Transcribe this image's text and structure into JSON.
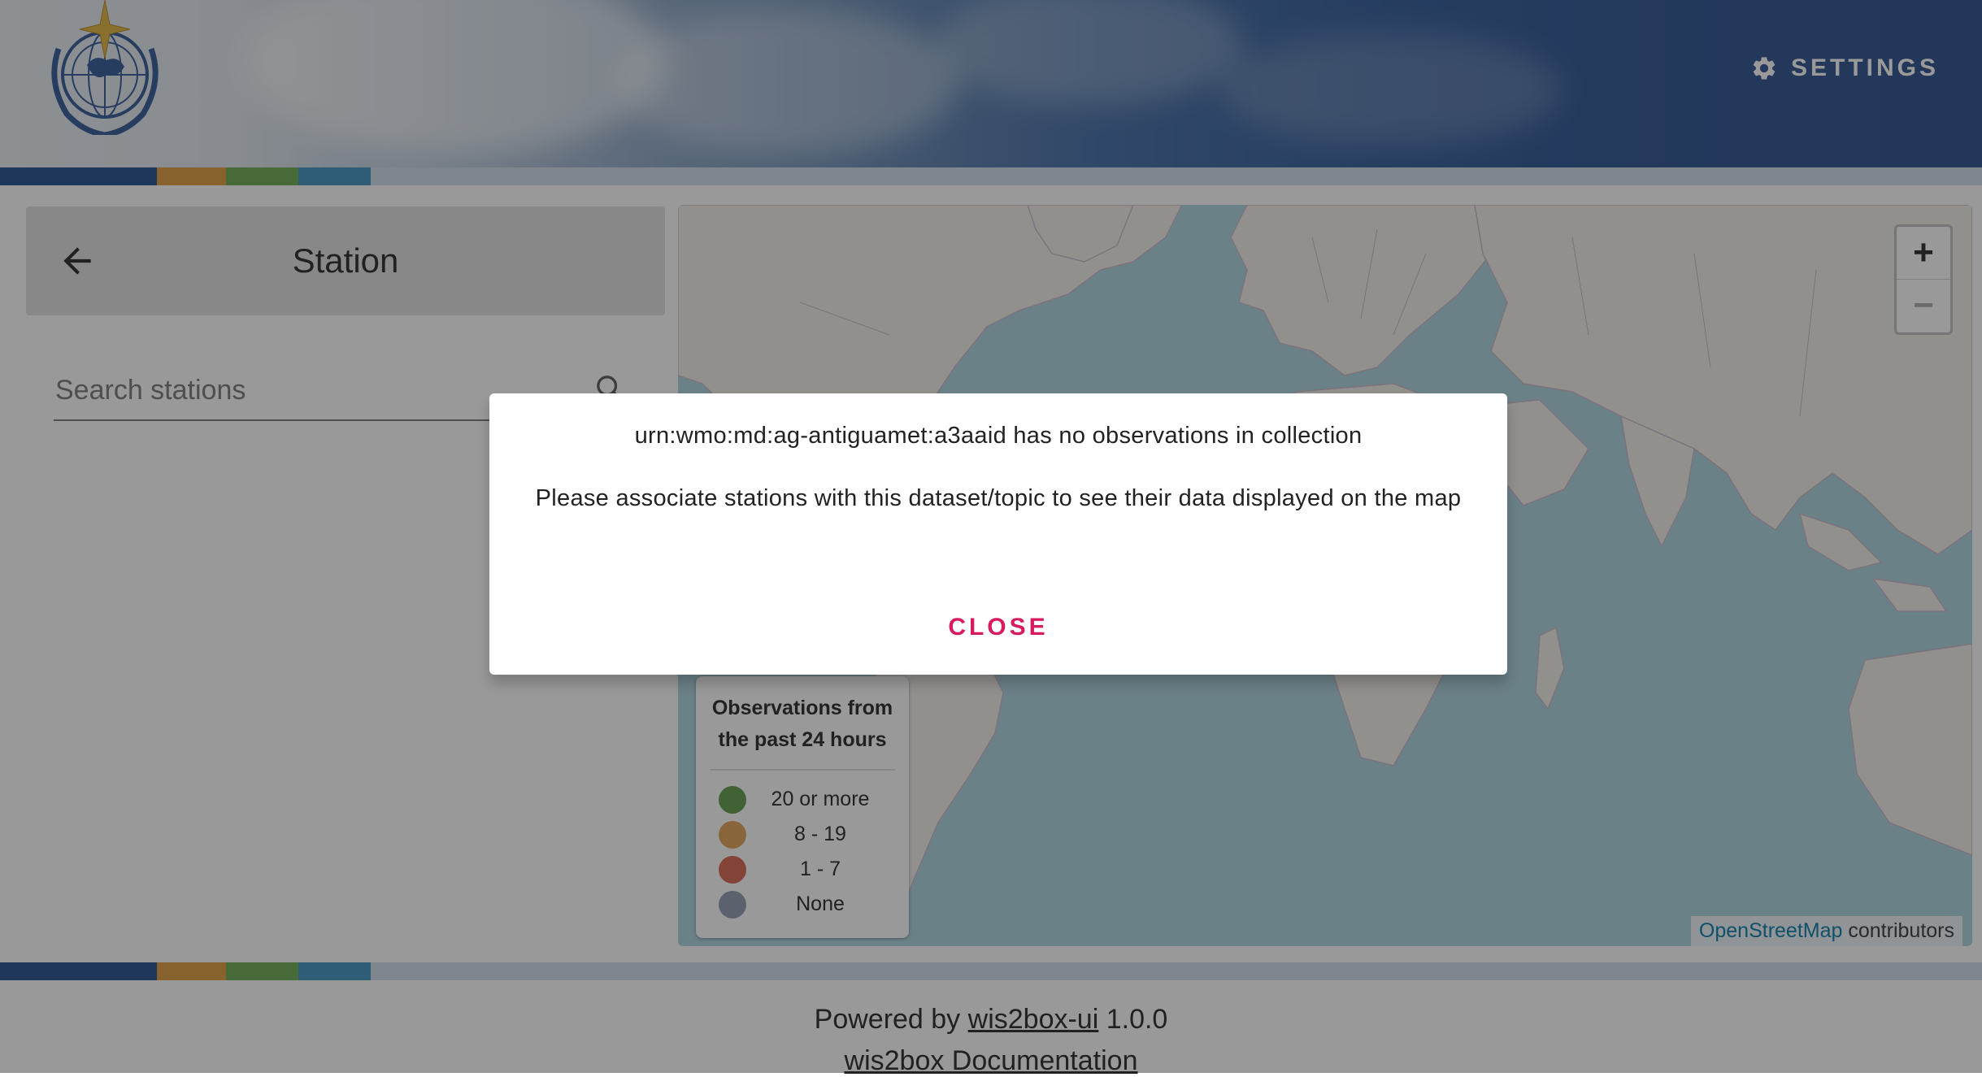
{
  "header": {
    "logo_icon": "wmo-logo-icon",
    "settings_icon": "gear-icon",
    "settings_label": "SETTINGS"
  },
  "stripe_colors": [
    "#1d4a8c",
    "#e19b38",
    "#6aa84f",
    "#3c90bf",
    "#cfdcea"
  ],
  "sidebar": {
    "back_icon": "arrow-left-icon",
    "title": "Station",
    "search": {
      "placeholder": "Search stations",
      "value": "",
      "icon": "search-icon"
    }
  },
  "map": {
    "zoom_in_label": "+",
    "zoom_out_label": "−",
    "legend": {
      "title": "Observations from the past 24 hours",
      "items": [
        {
          "label": "20 or more",
          "color": "#6aa84f"
        },
        {
          "label": "8 - 19",
          "color": "#e19b38"
        },
        {
          "label": "1 - 7",
          "color": "#e06040"
        },
        {
          "label": "None",
          "color": "#8d99ae"
        }
      ]
    },
    "attribution": {
      "link": "OpenStreetMap",
      "text": "contributors"
    }
  },
  "footer": {
    "powered_prefix": "Powered by",
    "powered_link": "wis2box-ui",
    "version": "1.0.0",
    "docs_link": "wis2box Documentation"
  },
  "dialog": {
    "message": "urn:wmo:md:ag-antiguamet:a3aaid has no observations in collection",
    "hint": "Please associate stations with this dataset/topic to see their data displayed on the map",
    "close_label": "CLOSE"
  }
}
